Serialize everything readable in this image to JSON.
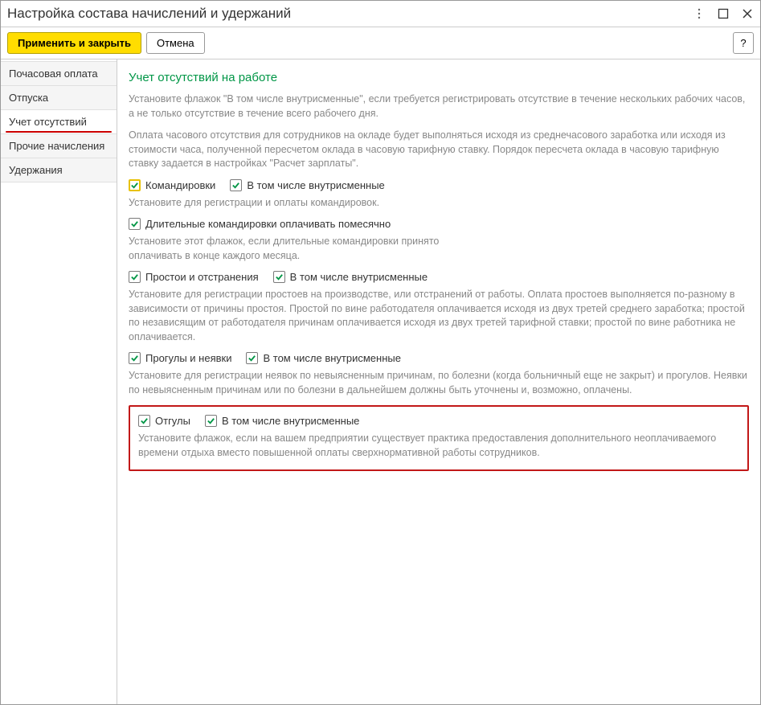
{
  "window": {
    "title": "Настройка состава начислений и удержаний"
  },
  "toolbar": {
    "apply_label": "Применить и закрыть",
    "cancel_label": "Отмена",
    "help_label": "?"
  },
  "sidebar": {
    "items": [
      {
        "label": "Почасовая оплата"
      },
      {
        "label": "Отпуска"
      },
      {
        "label": "Учет отсутствий"
      },
      {
        "label": "Прочие начисления"
      },
      {
        "label": "Удержания"
      }
    ]
  },
  "content": {
    "title": "Учет отсутствий на работе",
    "intro1": "Установите флажок \"В том числе внутрисменные\", если требуется регистрировать отсутствие в течение нескольких рабочих часов, а не только отсутствие в течение всего рабочего дня.",
    "intro2": "Оплата часового отсутствия для сотрудников на окладе будет выполняться исходя из среднечасового заработка или исходя из стоимости часа, полученной пересчетом оклада в часовую тарифную ставку. Порядок пересчета оклада в часовую тарифную ставку задается в настройках \"Расчет зарплаты\".",
    "group1": {
      "chk1": "Командировки",
      "chk2": "В том числе внутрисменные",
      "desc": "Установите для регистрации и оплаты командировок."
    },
    "group2": {
      "chk1": "Длительные командировки оплачивать помесячно",
      "desc": "Установите этот флажок, если длительные командировки принято оплачивать в конце каждого месяца."
    },
    "group3": {
      "chk1": "Простои и отстранения",
      "chk2": "В том числе внутрисменные",
      "desc": "Установите для регистрации простоев на производстве, или отстранений от работы. Оплата простоев выполняется по-разному в зависимости от причины простоя. Простой по вине работодателя оплачивается исходя из двух третей среднего заработка; простой по независящим от работодателя причинам оплачивается исходя из двух третей тарифной ставки; простой по вине работника не оплачивается."
    },
    "group4": {
      "chk1": "Прогулы и неявки",
      "chk2": "В том числе внутрисменные",
      "desc": "Установите для регистрации неявок по невыясненным причинам, по болезни (когда больничный еще не закрыт) и прогулов. Неявки по невыясненным причинам или по болезни в дальнейшем должны быть уточнены и, возможно, оплачены."
    },
    "group5": {
      "chk1": "Отгулы",
      "chk2": "В том числе внутрисменные",
      "desc": "Установите флажок, если на вашем предприятии существует практика предоставления дополнительного неоплачиваемого времени отдыха вместо повышенной оплаты сверхнормативной работы сотрудников."
    }
  }
}
